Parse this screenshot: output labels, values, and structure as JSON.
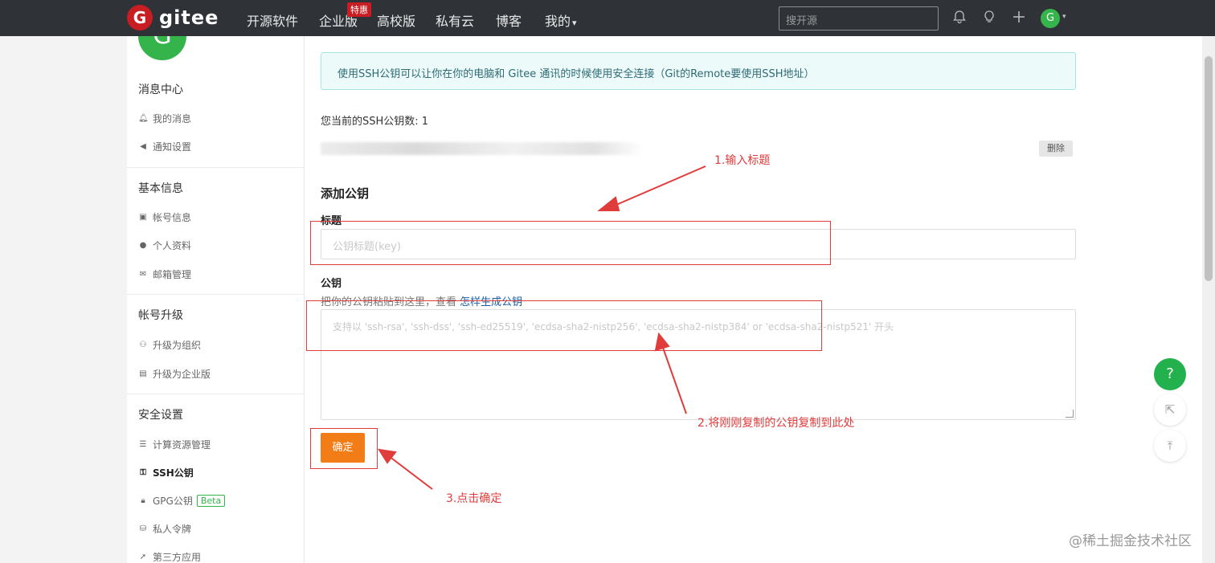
{
  "header": {
    "logo_mark": "G",
    "logo_text": "gitee",
    "nav": [
      "开源软件",
      "企业版",
      "高校版",
      "私有云",
      "博客",
      "我的"
    ],
    "badge": "特惠",
    "search_placeholder": "搜开源",
    "avatar": "G",
    "dropdown_caret": "▾"
  },
  "sidebar": {
    "avatar": "G",
    "groups": [
      {
        "title": "消息中心",
        "items": [
          "我的消息",
          "通知设置"
        ]
      },
      {
        "title": "基本信息",
        "items": [
          "帐号信息",
          "个人资料",
          "邮箱管理"
        ]
      },
      {
        "title": "帐号升级",
        "items": [
          "升级为组织",
          "升级为企业版"
        ]
      },
      {
        "title": "安全设置",
        "items": [
          "计算资源管理",
          "SSH公钥",
          "GPG公钥",
          "私人令牌",
          "第三方应用"
        ]
      }
    ],
    "beta_label": "Beta"
  },
  "main": {
    "tip": "使用SSH公钥可以让你在你的电脑和 Gitee 通讯的时候使用安全连接（Git的Remote要使用SSH地址）",
    "count_text": "您当前的SSH公钥数: 1",
    "delete_label": "删除",
    "section_title": "添加公钥",
    "title_label": "标题",
    "title_placeholder": "公钥标题(key)",
    "key_label": "公钥",
    "key_hint": "把你的公钥粘贴到这里，查看",
    "key_hint_link": "怎样生成公钥",
    "key_placeholder": "支持以 'ssh-rsa', 'ssh-dss', 'ssh-ed25519', 'ecdsa-sha2-nistp256', 'ecdsa-sha2-nistp384' or 'ecdsa-sha2-nistp521' 开头",
    "confirm_label": "确定"
  },
  "annotations": {
    "step1": "1.输入标题",
    "step2": "2.将刚刚复制的公钥复制到此处",
    "step3": "3.点击确定",
    "color": "#e13c3c"
  },
  "float_buttons": {
    "help": "?",
    "external": "⇱",
    "top": "⤒"
  },
  "watermark": "@稀土掘金技术社区"
}
